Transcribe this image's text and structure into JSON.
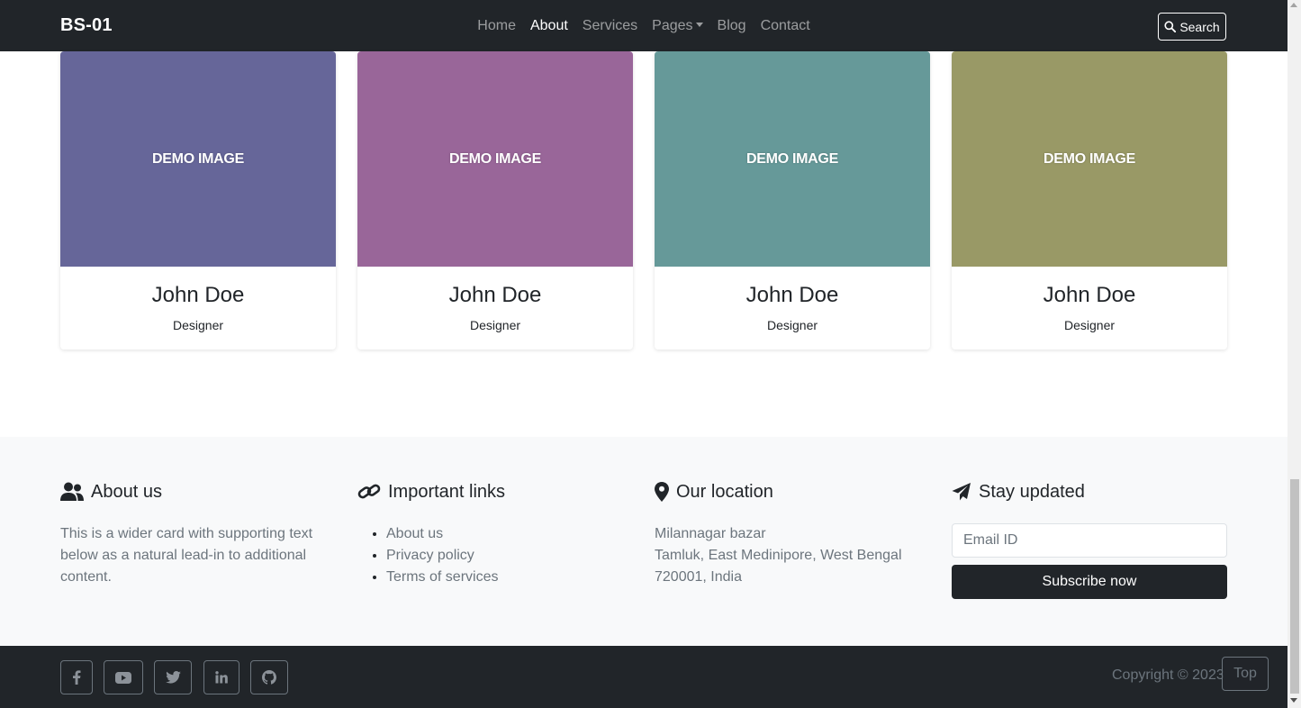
{
  "navbar": {
    "brand": "BS-01",
    "links": [
      {
        "label": "Home"
      },
      {
        "label": "About"
      },
      {
        "label": "Services"
      },
      {
        "label": "Pages"
      },
      {
        "label": "Blog"
      },
      {
        "label": "Contact"
      }
    ],
    "active": "About",
    "search_label": "Search"
  },
  "team": {
    "cards": [
      {
        "image_text": "DEMO IMAGE",
        "color": "#666699",
        "name": "John Doe",
        "role": "Designer"
      },
      {
        "image_text": "DEMO IMAGE",
        "color": "#996699",
        "name": "John Doe",
        "role": "Designer"
      },
      {
        "image_text": "DEMO IMAGE",
        "color": "#669999",
        "name": "John Doe",
        "role": "Designer"
      },
      {
        "image_text": "DEMO IMAGE",
        "color": "#999966",
        "name": "John Doe",
        "role": "Designer"
      }
    ]
  },
  "footer": {
    "about": {
      "icon": "users-icon",
      "title": "About us",
      "text": "This is a wider card with supporting text below as a natural lead-in to additional content."
    },
    "links": {
      "icon": "link-icon",
      "title": "Important links",
      "items": [
        "About us",
        "Privacy policy",
        "Terms of services"
      ]
    },
    "location": {
      "icon": "map-pin-icon",
      "title": "Our location",
      "lines": [
        "Milannagar bazar",
        "Tamluk, East Medinipore, West Bengal",
        "720001, India"
      ]
    },
    "newsletter": {
      "icon": "paper-plane-icon",
      "title": "Stay updated",
      "email_placeholder": "Email ID",
      "button_label": "Subscribe now"
    }
  },
  "bottom": {
    "social": [
      "facebook-icon",
      "youtube-icon",
      "twitter-icon",
      "linkedin-icon",
      "github-icon"
    ],
    "copyright": "Copyright © 2023",
    "top_label": "Top"
  },
  "colors": {
    "dark": "#212529",
    "muted": "#6c757d",
    "light_bg": "#f8f9fa"
  }
}
